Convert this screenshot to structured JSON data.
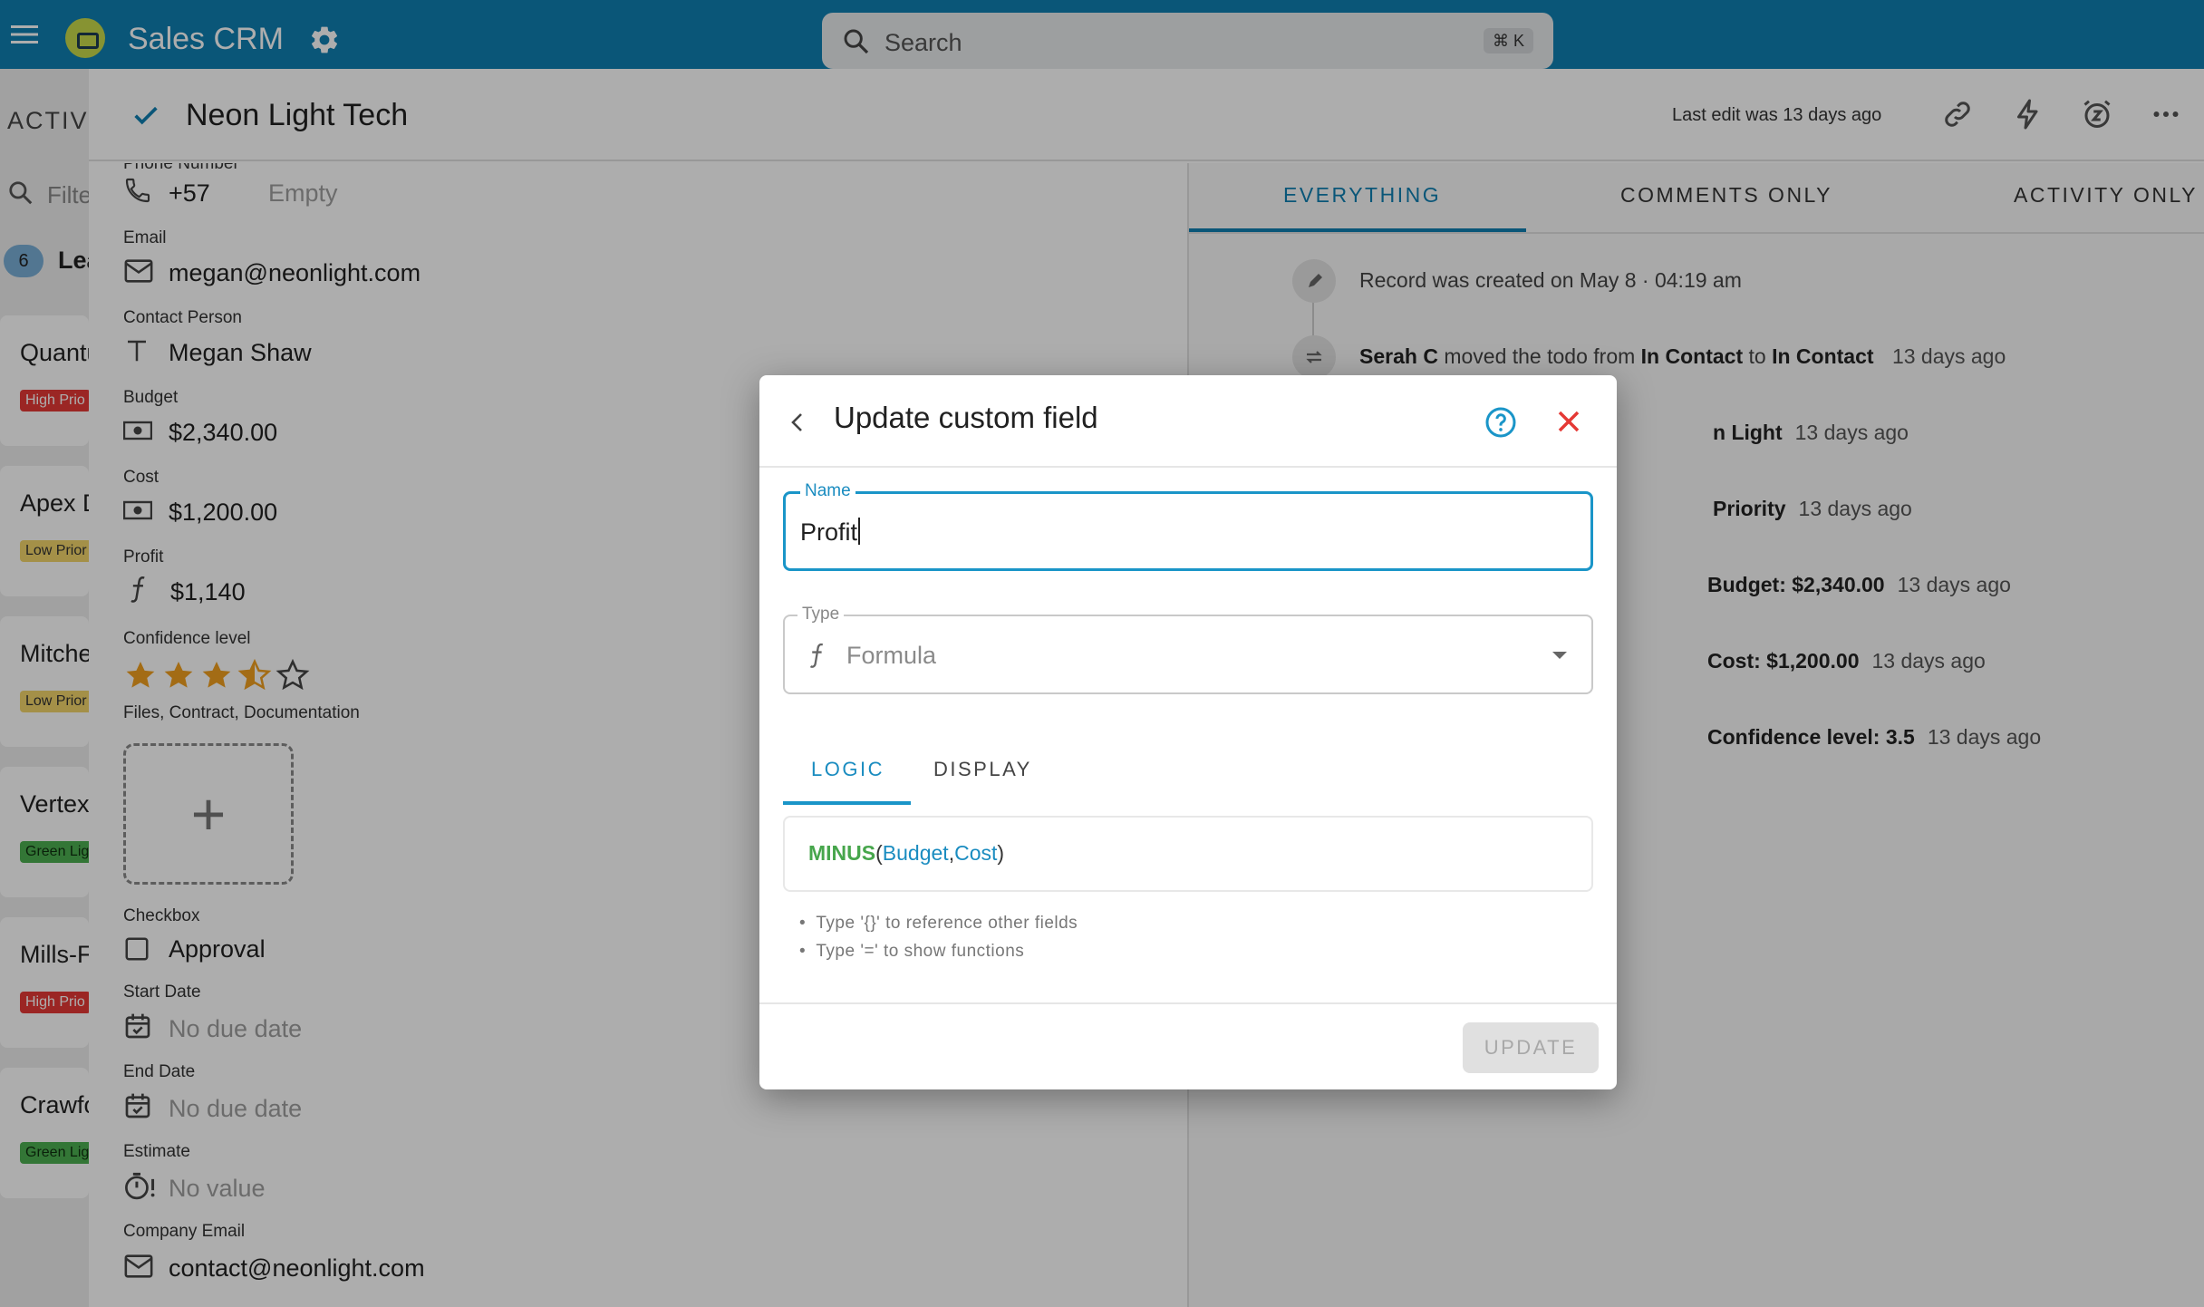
{
  "app": {
    "title": "Sales CRM"
  },
  "search": {
    "placeholder": "Search",
    "shortcut": "⌘ K"
  },
  "board": {
    "column_title": "ACTIVI",
    "filter_placeholder": "Filte",
    "lead_count": "6",
    "lead_label": "Lea",
    "cards": [
      {
        "title": "Quantu",
        "tag": "High Prio",
        "tag_color": "#e53935"
      },
      {
        "title": "Apex D",
        "tag": "Low Prior",
        "tag_color": "#f2d56b"
      },
      {
        "title": "Mitche",
        "tag": "Low Prior",
        "tag_color": "#f2d56b"
      },
      {
        "title": "Vertex",
        "tag": "Green Lig",
        "tag_color": "#4caf50"
      },
      {
        "title": "Mills-F",
        "tag": "High Prio",
        "tag_color": "#e53935"
      },
      {
        "title": "Crawfo",
        "tag": "Green Lig",
        "tag_color": "#4caf50"
      }
    ]
  },
  "record": {
    "title": "Neon Light Tech",
    "last_edit": "Last edit was 13 days ago",
    "fields": {
      "phone_label": "Phone Number",
      "phone_code": "+57",
      "phone_value": "Empty",
      "email_label": "Email",
      "email_value": "megan@neonlight.com",
      "contact_label": "Contact Person",
      "contact_value": "Megan Shaw",
      "budget_label": "Budget",
      "budget_value": "$2,340.00",
      "cost_label": "Cost",
      "cost_value": "$1,200.00",
      "profit_label": "Profit",
      "profit_value": "$1,140",
      "confidence_label": "Confidence level",
      "confidence_value": 3.5,
      "confidence_max": 5,
      "files_label": "Files, Contract, Documentation",
      "checkbox_label": "Checkbox",
      "checkbox_value": "Approval",
      "start_label": "Start Date",
      "start_value": "No due date",
      "end_label": "End Date",
      "end_value": "No due date",
      "estimate_label": "Estimate",
      "estimate_value": "No value",
      "company_email_label": "Company Email",
      "company_email_value": "contact@neonlight.com"
    }
  },
  "activity": {
    "tabs": [
      "EVERYTHING",
      "COMMENTS ONLY",
      "ACTIVITY ONLY"
    ],
    "active_tab": "EVERYTHING",
    "created": "Record was created on May 8 · 04:19 am",
    "move": {
      "user": "Serah C",
      "text": "moved the todo from",
      "from": "In Contact",
      "to_word": "to",
      "to": "In Contact",
      "time": "13 days ago"
    },
    "items": [
      {
        "bold": "n Light",
        "time": "13 days ago"
      },
      {
        "bold": "Priority",
        "time": "13 days ago"
      },
      {
        "bold": "Budget: $2,340.00",
        "time": "13 days ago"
      },
      {
        "bold": "Cost: $1,200.00",
        "time": "13 days ago"
      },
      {
        "bold": "Confidence level: 3.5",
        "time": "13 days ago"
      }
    ]
  },
  "modal": {
    "title": "Update custom field",
    "name_label": "Name",
    "name_value": "Profit",
    "type_label": "Type",
    "type_value": "Formula",
    "tabs": [
      "LOGIC",
      "DISPLAY"
    ],
    "active_tab": "LOGIC",
    "formula": {
      "fn": "MINUS",
      "open": "(",
      "arg1": "Budget",
      "sep": ",",
      "arg2": "Cost",
      "close": ")"
    },
    "hints": [
      "Type '{}' to reference other fields",
      "Type '=' to show functions"
    ],
    "update_label": "UPDATE"
  },
  "colors": {
    "primary": "#0f7fb2",
    "accent": "#1a95c8",
    "star": "#f0a020",
    "close": "#e53935",
    "formula_fn": "#47a64c"
  }
}
